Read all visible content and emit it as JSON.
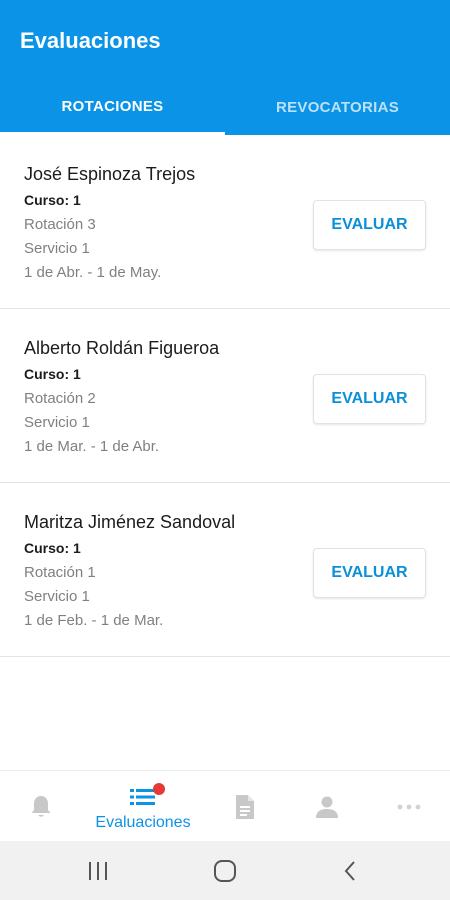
{
  "appbar": {
    "title": "Evaluaciones",
    "color": "#0b93e8"
  },
  "tabs": [
    {
      "label": "ROTACIONES",
      "active": true
    },
    {
      "label": "REVOCATORIAS",
      "active": false
    }
  ],
  "evaluations": [
    {
      "name": "José Espinoza Trejos",
      "course": "Curso: 1",
      "rotation": "Rotación 3",
      "service": "Servicio 1",
      "dates": "1 de Abr. - 1 de May.",
      "button": "EVALUAR"
    },
    {
      "name": "Alberto Roldán Figueroa",
      "course": "Curso: 1",
      "rotation": "Rotación 2",
      "service": "Servicio 1",
      "dates": "1 de Mar. - 1 de Abr.",
      "button": "EVALUAR"
    },
    {
      "name": "Maritza Jiménez Sandoval",
      "course": "Curso: 1",
      "rotation": "Rotación 1",
      "service": "Servicio 1",
      "dates": "1 de Feb. - 1 de Mar.",
      "button": "EVALUAR"
    }
  ],
  "bottom_nav": {
    "items": [
      {
        "icon": "bell-icon"
      },
      {
        "icon": "list-icon",
        "label": "Evaluaciones",
        "active": true,
        "badge": true
      },
      {
        "icon": "document-icon"
      },
      {
        "icon": "person-icon"
      },
      {
        "icon": "more-icon"
      }
    ],
    "badge_color": "#e53935"
  },
  "system_nav": {
    "icons": [
      "recent-apps-icon",
      "home-icon",
      "back-icon"
    ]
  }
}
